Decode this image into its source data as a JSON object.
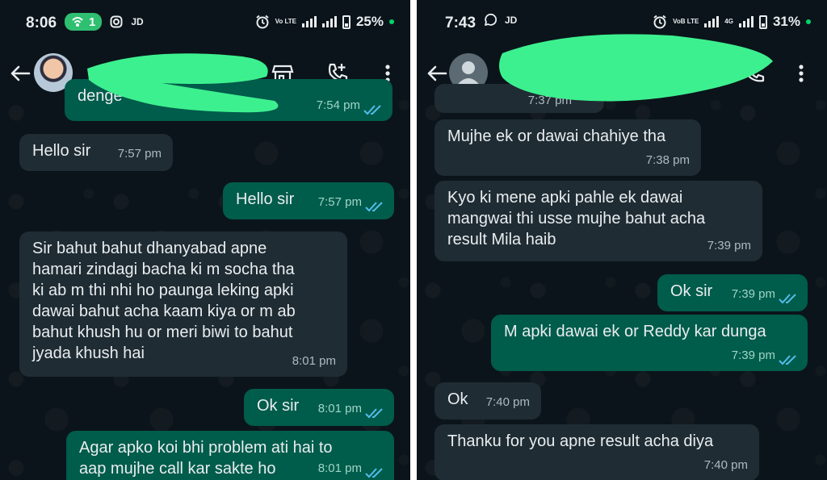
{
  "left_panel": {
    "status": {
      "time": "8:06",
      "hotspot_count": "1",
      "carrier_tag": "JD",
      "network_tag": "Vo LTE",
      "battery": "25%"
    },
    "partial_message": {
      "text": "denge",
      "time": "7:54 pm"
    },
    "messages": [
      {
        "dir": "in",
        "lines": [
          "Hello sir"
        ],
        "time": "7:57 pm"
      },
      {
        "dir": "out",
        "lines": [
          "Hello sir"
        ],
        "time": "7:57 pm"
      },
      {
        "dir": "in",
        "lines": [
          "Sir bahut bahut dhanyabad apne",
          "hamari zindagi bacha ki m socha tha",
          "ki ab m thi nhi ho paunga leking apki",
          "dawai bahut acha kaam kiya or m ab",
          "bahut khush hu or meri biwi to bahut",
          "jyada khush hai"
        ],
        "time": "8:01 pm"
      },
      {
        "dir": "out",
        "lines": [
          "Ok sir"
        ],
        "time": "8:01 pm"
      },
      {
        "dir": "out",
        "lines": [
          "Agar apko koi bhi problem ati hai to",
          "aap mujhe call kar sakte ho"
        ],
        "time": "8:01 pm"
      }
    ]
  },
  "right_panel": {
    "status": {
      "time": "7:43",
      "carrier_tag": "JD",
      "network_tag": "VoB LTE",
      "network_tag_2": "4G",
      "battery": "31%"
    },
    "partial_message": {
      "text": "",
      "time": "7:37 pm"
    },
    "messages": [
      {
        "dir": "in",
        "lines": [
          "Mujhe ek or dawai chahiye tha"
        ],
        "time": "7:38 pm"
      },
      {
        "dir": "in",
        "lines": [
          "Kyo ki mene apki pahle ek dawai",
          "mangwai thi usse mujhe bahut acha",
          "result Mila haib"
        ],
        "time": "7:39 pm"
      },
      {
        "dir": "out",
        "lines": [
          "Ok sir"
        ],
        "time": "7:39 pm"
      },
      {
        "dir": "out",
        "lines": [
          "M apki dawai ek or Reddy kar dunga"
        ],
        "time": "7:39 pm"
      },
      {
        "dir": "in",
        "lines": [
          "Ok"
        ],
        "time": "7:40 pm"
      },
      {
        "dir": "in",
        "lines": [
          "Thanku for you  apne result acha diya"
        ],
        "time": "7:40 pm"
      }
    ]
  },
  "colors": {
    "chat_bg": "#0b141a",
    "incoming_bubble": "#1f2c34",
    "outgoing_bubble": "#005c4b",
    "redaction": "#3df08f",
    "ticks": "#53bdeb",
    "hotspot": "#2fbf71"
  },
  "icons": [
    "back-arrow-icon",
    "store-icon",
    "add-call-icon",
    "video-call-icon",
    "more-vert-icon",
    "alarm-icon",
    "whatsapp-icon",
    "instagram-icon",
    "hotspot-icon"
  ]
}
